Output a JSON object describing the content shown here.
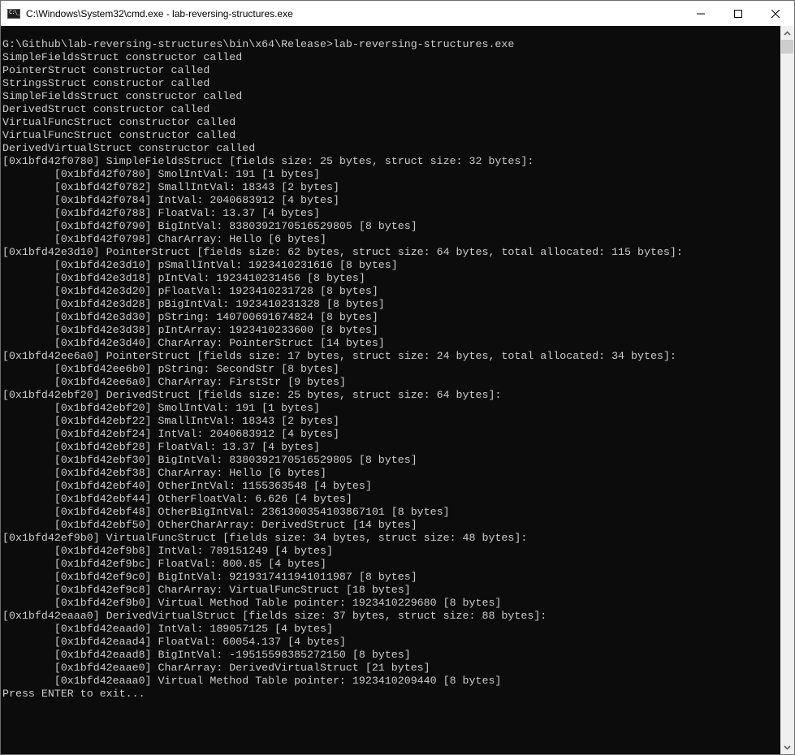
{
  "window": {
    "title": "C:\\Windows\\System32\\cmd.exe - lab-reversing-structures.exe",
    "icon": "cmd-icon",
    "controls": {
      "minimize": "minimize-icon",
      "maximize": "maximize-icon",
      "close": "close-icon"
    }
  },
  "console": {
    "lines": [
      "G:\\Github\\lab-reversing-structures\\bin\\x64\\Release>lab-reversing-structures.exe",
      "SimpleFieldsStruct constructor called",
      "PointerStruct constructor called",
      "StringsStruct constructor called",
      "SimpleFieldsStruct constructor called",
      "DerivedStruct constructor called",
      "VirtualFuncStruct constructor called",
      "VirtualFuncStruct constructor called",
      "DerivedVirtualStruct constructor called",
      "[0x1bfd42f0780] SimpleFieldsStruct [fields size: 25 bytes, struct size: 32 bytes]:",
      "        [0x1bfd42f0780] SmolIntVal: 191 [1 bytes]",
      "        [0x1bfd42f0782] SmallIntVal: 18343 [2 bytes]",
      "        [0x1bfd42f0784] IntVal: 2040683912 [4 bytes]",
      "        [0x1bfd42f0788] FloatVal: 13.37 [4 bytes]",
      "        [0x1bfd42f0790] BigIntVal: 8380392170516529805 [8 bytes]",
      "        [0x1bfd42f0798] CharArray: Hello [6 bytes]",
      "[0x1bfd42e3d10] PointerStruct [fields size: 62 bytes, struct size: 64 bytes, total allocated: 115 bytes]:",
      "        [0x1bfd42e3d10] pSmallIntVal: 1923410231616 [8 bytes]",
      "        [0x1bfd42e3d18] pIntVal: 1923410231456 [8 bytes]",
      "        [0x1bfd42e3d20] pFloatVal: 1923410231728 [8 bytes]",
      "        [0x1bfd42e3d28] pBigIntVal: 1923410231328 [8 bytes]",
      "        [0x1bfd42e3d30] pString: 140700691674824 [8 bytes]",
      "        [0x1bfd42e3d38] pIntArray: 1923410233600 [8 bytes]",
      "        [0x1bfd42e3d40] CharArray: PointerStruct [14 bytes]",
      "[0x1bfd42ee6a0] PointerStruct [fields size: 17 bytes, struct size: 24 bytes, total allocated: 34 bytes]:",
      "        [0x1bfd42ee6b0] pString: SecondStr [8 bytes]",
      "        [0x1bfd42ee6a0] CharArray: FirstStr [9 bytes]",
      "[0x1bfd42ebf20] DerivedStruct [fields size: 25 bytes, struct size: 64 bytes]:",
      "        [0x1bfd42ebf20] SmolIntVal: 191 [1 bytes]",
      "        [0x1bfd42ebf22] SmallIntVal: 18343 [2 bytes]",
      "        [0x1bfd42ebf24] IntVal: 2040683912 [4 bytes]",
      "        [0x1bfd42ebf28] FloatVal: 13.37 [4 bytes]",
      "        [0x1bfd42ebf30] BigIntVal: 8380392170516529805 [8 bytes]",
      "        [0x1bfd42ebf38] CharArray: Hello [6 bytes]",
      "        [0x1bfd42ebf40] OtherIntVal: 1155363548 [4 bytes]",
      "        [0x1bfd42ebf44] OtherFloatVal: 6.626 [4 bytes]",
      "        [0x1bfd42ebf48] OtherBigIntVal: 2361300354103867101 [8 bytes]",
      "        [0x1bfd42ebf50] OtherCharArray: DerivedStruct [14 bytes]",
      "[0x1bfd42ef9b0] VirtualFuncStruct [fields size: 34 bytes, struct size: 48 bytes]:",
      "        [0x1bfd42ef9b8] IntVal: 789151249 [4 bytes]",
      "        [0x1bfd42ef9bc] FloatVal: 800.85 [4 bytes]",
      "        [0x1bfd42ef9c0] BigIntVal: 9219317411941011987 [8 bytes]",
      "        [0x1bfd42ef9c8] CharArray: VirtualFuncStruct [18 bytes]",
      "        [0x1bfd42ef9b0] Virtual Method Table pointer: 1923410229680 [8 bytes]",
      "[0x1bfd42eaaa0] DerivedVirtualStruct [fields size: 37 bytes, struct size: 88 bytes]:",
      "        [0x1bfd42eaad0] IntVal: 189057125 [4 bytes]",
      "        [0x1bfd42eaad4] FloatVal: 60054.137 [4 bytes]",
      "        [0x1bfd42eaad8] BigIntVal: -19515598385272150 [8 bytes]",
      "        [0x1bfd42eaae0] CharArray: DerivedVirtualStruct [21 bytes]",
      "        [0x1bfd42eaaa0] Virtual Method Table pointer: 1923410209440 [8 bytes]",
      "Press ENTER to exit..."
    ]
  },
  "scrollbar": {
    "up": "chevron-up-icon",
    "down": "chevron-down-icon"
  },
  "colors": {
    "console_bg": "#0c0c0c",
    "console_fg": "#cccccc",
    "titlebar_bg": "#ffffff",
    "scrollbar_bg": "#f0f0f0"
  }
}
